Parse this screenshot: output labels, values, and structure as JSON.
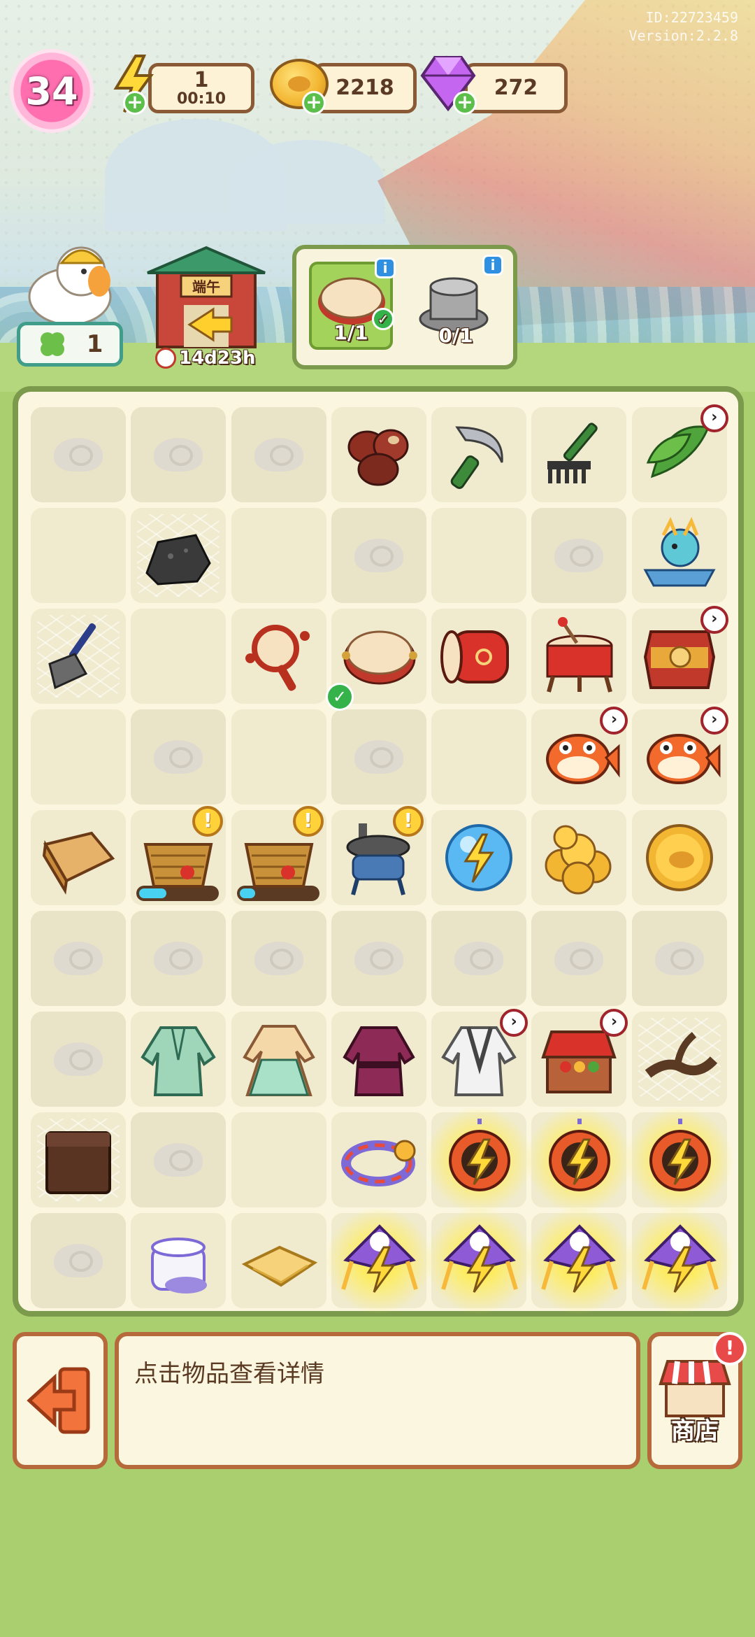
{
  "meta": {
    "id_text": "ID:22723459",
    "version_text": "Version:2.2.8"
  },
  "header": {
    "level": "34",
    "energy": {
      "value": "1",
      "timer": "00:10"
    },
    "coins": {
      "value": "2218"
    },
    "gems": {
      "value": "272"
    }
  },
  "companion": {
    "clover_count": "1"
  },
  "event": {
    "gate_sign": "端午",
    "timer": "14d23h"
  },
  "order": {
    "slots": [
      {
        "item": "drum-tambourine",
        "progress": "1/1",
        "complete": true
      },
      {
        "item": "stone-mill",
        "progress": "0/1",
        "complete": false
      }
    ]
  },
  "board": {
    "rows": 9,
    "cols": 7,
    "cells": [
      [
        "locked",
        "locked",
        "locked",
        "dates",
        "sickle",
        "rake",
        "leaves-arrow"
      ],
      [
        "empty",
        "stone-web",
        "empty",
        "locked",
        "empty",
        "locked",
        "dragon-boat"
      ],
      [
        "broom-web",
        "empty",
        "rattle-drum",
        "tambourine-check",
        "red-drum",
        "drum-stand",
        "big-drum-arrow"
      ],
      [
        "empty",
        "locked",
        "empty",
        "locked",
        "empty",
        "koi-arrow",
        "koi-arrow"
      ],
      [
        "wood-log",
        "basket-progress",
        "basket-progress",
        "stove-alert",
        "energy-orb",
        "coin-pile",
        "coin"
      ],
      [
        "locked",
        "locked",
        "locked",
        "locked",
        "locked",
        "locked",
        "locked"
      ],
      [
        "locked",
        "green-robe",
        "hanfu-dress",
        "purple-robe",
        "white-robe-arrow",
        "stall-arrow",
        "branch-web"
      ],
      [
        "box-web",
        "locked",
        "empty",
        "dragon-ring",
        "fan-energy",
        "fan-energy",
        "fan-energy"
      ],
      [
        "locked",
        "cream-jar",
        "cloth",
        "kite-energy",
        "kite-energy",
        "kite-energy",
        "kite-energy"
      ]
    ],
    "progress_fill": [
      0.35,
      0.2
    ]
  },
  "footer": {
    "hint": "点击物品查看详情",
    "shop_label": "商店"
  },
  "colors": {
    "frame_green": "#7b9a4c",
    "frame_brown": "#b66a3b",
    "level_pink": "#ff6fb0",
    "coin_gold": "#f3b632",
    "gem_purple": "#b04fe0"
  }
}
